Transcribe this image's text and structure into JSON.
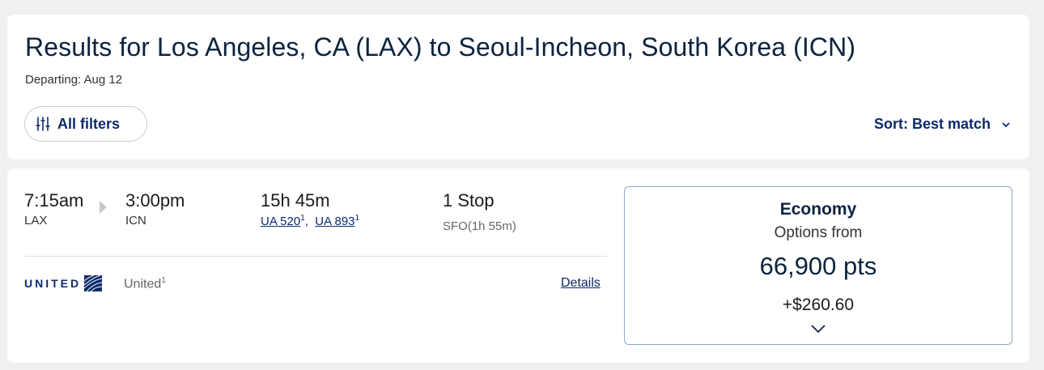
{
  "header": {
    "title": "Results for Los Angeles, CA (LAX) to Seoul-Incheon, South Korea (ICN)",
    "departing": "Departing: Aug 12",
    "filters_label": "All filters",
    "filters_icon": "sliders-icon",
    "sort_label": "Sort: Best match",
    "sort_icon": "chevron-down-icon"
  },
  "result": {
    "depart_time": "7:15am",
    "depart_code": "LAX",
    "arrive_time": "3:00pm",
    "arrive_code": "ICN",
    "duration": "15h 45m",
    "flights": [
      {
        "number": "UA 520",
        "sup": "1"
      },
      {
        "number": "UA 893",
        "sup": "1"
      }
    ],
    "stops": "1 Stop",
    "layover": "SFO(1h 55m)",
    "airline_wordmark": "UNITED",
    "airline_name": "United",
    "airline_sup": "1",
    "details_label": "Details"
  },
  "fare": {
    "cabin": "Economy",
    "from_label": "Options from",
    "points": "66,900 pts",
    "cash": "+$260.60",
    "expand_icon": "chevron-down-icon"
  },
  "colors": {
    "brand_navy": "#0c2a6b",
    "title_navy": "#0c2340",
    "fare_border": "#8ca7c9",
    "page_bg": "#eef0f2"
  }
}
